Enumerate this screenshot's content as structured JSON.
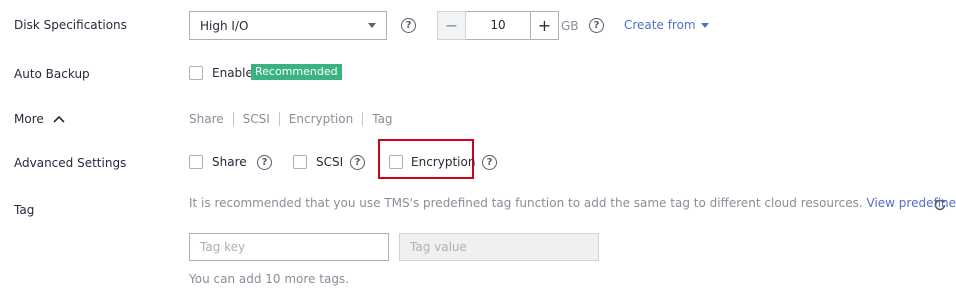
{
  "disk_specifications": {
    "label": "Disk Specifications",
    "disk_type": "High I/O",
    "size_value": "10",
    "size_unit": "GB",
    "minus": "−",
    "plus": "+",
    "create_from": "Create from",
    "help": "?"
  },
  "auto_backup": {
    "label": "Auto Backup",
    "enable_label": "Enable",
    "badge": "Recommended",
    "badge_color": "#3bb282"
  },
  "more": {
    "label": "More",
    "links": [
      "Share",
      "SCSI",
      "Encryption",
      "Tag"
    ]
  },
  "advanced_settings": {
    "label": "Advanced Settings",
    "options": [
      "Share",
      "SCSI",
      "Encryption"
    ],
    "highlight_color": "#d0021b"
  },
  "tag": {
    "label": "Tag",
    "description": "It is recommended that you use TMS's predefined tag function to add the same tag to different cloud resources.",
    "view_link": "View predefined tags",
    "key_placeholder": "Tag key",
    "value_placeholder": "Tag value",
    "limit_note": "You can add 10 more tags."
  },
  "colors": {
    "link": "#526ecc",
    "text": "#252b3a",
    "muted": "#8a8e99"
  }
}
